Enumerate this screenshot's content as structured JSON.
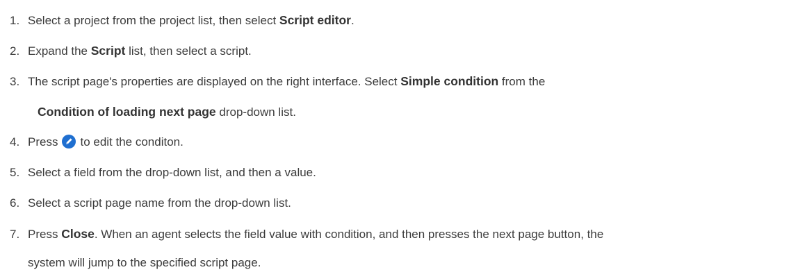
{
  "steps": [
    {
      "number": "1.",
      "parts": [
        "Select a project from the project list, then select ",
        "Script editor",
        "."
      ]
    },
    {
      "number": "2.",
      "parts": [
        "Expand the ",
        "Script",
        " list, then select a script."
      ]
    },
    {
      "number": "3.",
      "parts": [
        "The script page's properties are displayed on the right interface. Select ",
        "Simple condition",
        " from the"
      ],
      "continuation": [
        "Condition of loading next page",
        " drop-down list."
      ]
    },
    {
      "number": "4.",
      "parts": [
        "Press",
        "to edit the conditon."
      ],
      "icon": "edit-pencil-icon",
      "icon_color": "#1f6fd0"
    },
    {
      "number": "5.",
      "parts": [
        "Select a field from the drop-down list, and then a value."
      ]
    },
    {
      "number": "6.",
      "parts": [
        "Select a script page name from the drop-down list."
      ]
    },
    {
      "number": "7.",
      "parts": [
        "Press ",
        "Close",
        ". When an agent selects the field value with condition, and then presses the next page button, the"
      ],
      "continuation": [
        "system will jump to the specified script page."
      ]
    }
  ]
}
